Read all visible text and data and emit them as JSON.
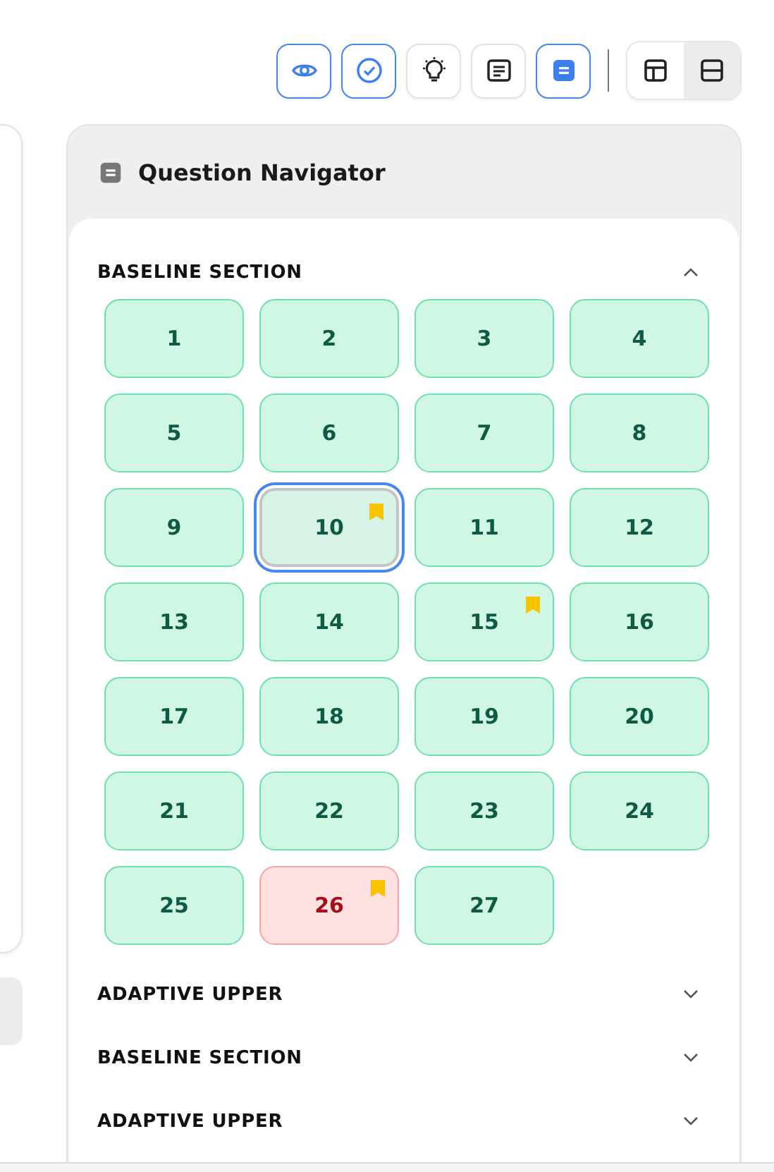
{
  "toolbar": {
    "tools": [
      {
        "kind": "eye",
        "on": true
      },
      {
        "kind": "check",
        "on": true
      },
      {
        "kind": "bulb",
        "on": false
      },
      {
        "kind": "notes",
        "on": false
      },
      {
        "kind": "navigator",
        "on": true
      }
    ],
    "layouts": [
      {
        "kind": "split",
        "selected": false
      },
      {
        "kind": "stacked",
        "selected": true
      }
    ]
  },
  "navigator": {
    "title": "Question Navigator",
    "sections": [
      {
        "title": "BASELINE SECTION",
        "expanded": true,
        "questions": [
          {
            "number": "1",
            "incorrect": false,
            "bookmarked": false,
            "selected": false
          },
          {
            "number": "2",
            "incorrect": false,
            "bookmarked": false,
            "selected": false
          },
          {
            "number": "3",
            "incorrect": false,
            "bookmarked": false,
            "selected": false
          },
          {
            "number": "4",
            "incorrect": false,
            "bookmarked": false,
            "selected": false
          },
          {
            "number": "5",
            "incorrect": false,
            "bookmarked": false,
            "selected": false
          },
          {
            "number": "6",
            "incorrect": false,
            "bookmarked": false,
            "selected": false
          },
          {
            "number": "7",
            "incorrect": false,
            "bookmarked": false,
            "selected": false
          },
          {
            "number": "8",
            "incorrect": false,
            "bookmarked": false,
            "selected": false
          },
          {
            "number": "9",
            "incorrect": false,
            "bookmarked": false,
            "selected": false
          },
          {
            "number": "10",
            "incorrect": false,
            "bookmarked": true,
            "selected": true
          },
          {
            "number": "11",
            "incorrect": false,
            "bookmarked": false,
            "selected": false
          },
          {
            "number": "12",
            "incorrect": false,
            "bookmarked": false,
            "selected": false
          },
          {
            "number": "13",
            "incorrect": false,
            "bookmarked": false,
            "selected": false
          },
          {
            "number": "14",
            "incorrect": false,
            "bookmarked": false,
            "selected": false
          },
          {
            "number": "15",
            "incorrect": false,
            "bookmarked": true,
            "selected": false
          },
          {
            "number": "16",
            "incorrect": false,
            "bookmarked": false,
            "selected": false
          },
          {
            "number": "17",
            "incorrect": false,
            "bookmarked": false,
            "selected": false
          },
          {
            "number": "18",
            "incorrect": false,
            "bookmarked": false,
            "selected": false
          },
          {
            "number": "19",
            "incorrect": false,
            "bookmarked": false,
            "selected": false
          },
          {
            "number": "20",
            "incorrect": false,
            "bookmarked": false,
            "selected": false
          },
          {
            "number": "21",
            "incorrect": false,
            "bookmarked": false,
            "selected": false
          },
          {
            "number": "22",
            "incorrect": false,
            "bookmarked": false,
            "selected": false
          },
          {
            "number": "23",
            "incorrect": false,
            "bookmarked": false,
            "selected": false
          },
          {
            "number": "24",
            "incorrect": false,
            "bookmarked": false,
            "selected": false
          },
          {
            "number": "25",
            "incorrect": false,
            "bookmarked": false,
            "selected": false
          },
          {
            "number": "26",
            "incorrect": true,
            "bookmarked": true,
            "selected": false
          },
          {
            "number": "27",
            "incorrect": false,
            "bookmarked": false,
            "selected": false
          }
        ]
      },
      {
        "title": "ADAPTIVE UPPER",
        "expanded": false
      },
      {
        "title": "BASELINE SECTION",
        "expanded": false
      },
      {
        "title": "ADAPTIVE UPPER",
        "expanded": false
      }
    ]
  }
}
